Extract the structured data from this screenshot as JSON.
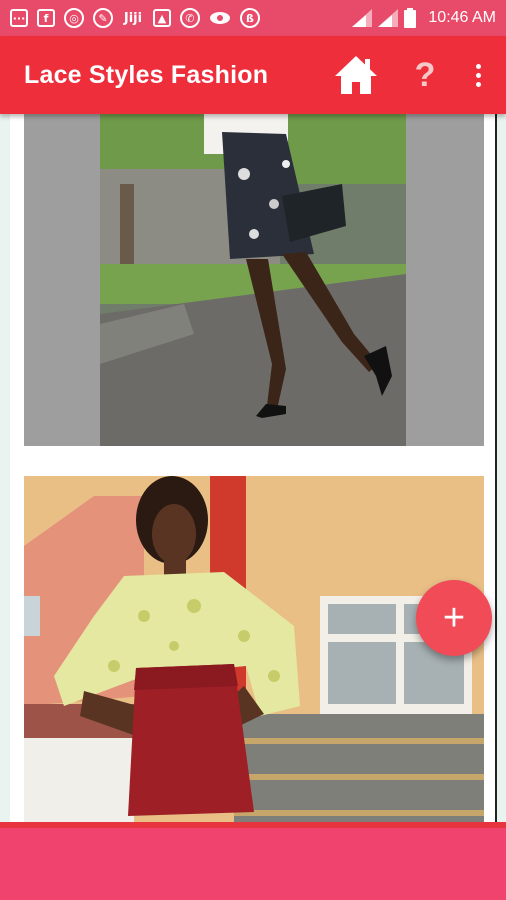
{
  "status_bar": {
    "time": "10:46 AM",
    "icons": [
      "chat-icon",
      "facebook-icon",
      "dribbble-icon",
      "compass-icon",
      "jiji-icon",
      "gallery-icon",
      "whatsapp-icon",
      "eye-icon",
      "opera-icon",
      "signal-icon",
      "signal-icon",
      "battery-icon"
    ],
    "jiji_label": "Jiji"
  },
  "app_bar": {
    "title": "Lace Styles Fashion",
    "help_label": "?",
    "background": "#ef2e3c"
  },
  "fab": {
    "label": "+",
    "color": "#f04b57"
  },
  "colors": {
    "status_bar": "#e84a6a",
    "bottom_bar": "#f0446f"
  }
}
